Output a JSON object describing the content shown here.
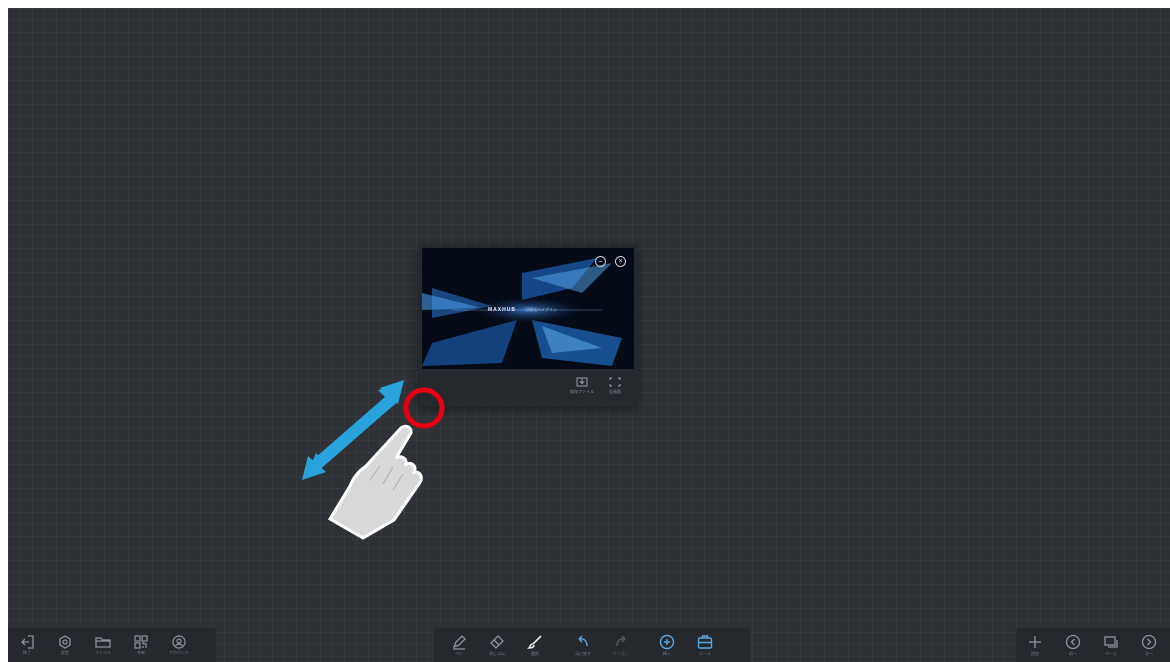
{
  "window": {
    "brand": "MAXHUB",
    "tagline": "可视化ハイブリッ",
    "minimize_icon": "minimize-icon",
    "close_icon": "close-icon",
    "footer": [
      {
        "label": "保存ファイル",
        "icon": "download-icon"
      },
      {
        "label": "全画面",
        "icon": "fullscreen-icon"
      }
    ]
  },
  "gesture": {
    "icons": [
      "double-arrow-icon",
      "hand-pointer-icon",
      "tap-circle-icon"
    ],
    "colors": {
      "arrow": "#29a3dc",
      "circle": "#e60012",
      "hand": "#d9d9d9"
    }
  },
  "toolbar_left": [
    {
      "label": "終了",
      "icon": "exit-icon"
    },
    {
      "label": "設定",
      "icon": "gear-icon"
    },
    {
      "label": "ファイル",
      "icon": "folder-icon"
    },
    {
      "label": "共有",
      "icon": "qr-icon"
    },
    {
      "label": "アカウント",
      "icon": "user-icon"
    }
  ],
  "toolbar_center": [
    {
      "label": "ペン",
      "icon": "pen-icon"
    },
    {
      "label": "消しゴム",
      "icon": "eraser-icon"
    },
    {
      "label": "選択",
      "icon": "brush-icon"
    },
    {
      "label": "元に戻す",
      "icon": "undo-icon"
    },
    {
      "label": "やり直し",
      "icon": "redo-icon"
    },
    {
      "label": "挿入",
      "icon": "add-circle-icon"
    },
    {
      "label": "ツール",
      "icon": "toolbox-icon"
    }
  ],
  "toolbar_right": [
    {
      "label": "追加",
      "icon": "plus-icon"
    },
    {
      "label": "前へ",
      "icon": "prev-icon"
    },
    {
      "label": "ページ",
      "icon": "pages-icon"
    },
    {
      "label": "次へ",
      "icon": "next-icon"
    }
  ],
  "colors": {
    "canvas": "#2e3136",
    "toolbar": "#25282d",
    "accent": "#5aa7e6"
  }
}
